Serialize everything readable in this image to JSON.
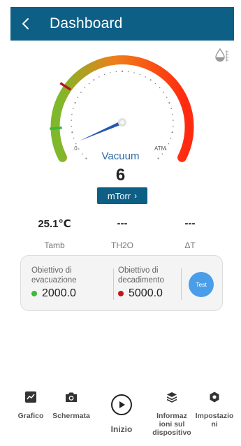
{
  "header": {
    "title": "Dashboard",
    "back_icon": "chevron-left-icon"
  },
  "top_right_icon": "water-drop-icon",
  "gauge": {
    "label": "Vacuum",
    "value": "6",
    "min_label": ".0",
    "max_label": "ATM.",
    "unit": "mTorr",
    "unit_chevron": "›",
    "needle_fraction": 0.08,
    "colors": {
      "green": "#7fb82a",
      "orange": "#f07d1a",
      "red": "#ff2b10",
      "needle": "#2457b0"
    }
  },
  "readings": [
    {
      "value": "25.1℃",
      "label": "Tamb"
    },
    {
      "value": "---",
      "label": "TH2O"
    },
    {
      "value": "---",
      "label": "ΔT"
    }
  ],
  "targets": {
    "evacuation": {
      "title_line1": "Obiettivo di",
      "title_line2": "evacuazione",
      "value": "2000.0",
      "dot_color": "#3db83a"
    },
    "decay": {
      "title_line1": "Obiettivo di",
      "title_line2": "decadimento",
      "value": "5000.0",
      "dot_color": "#c0161c"
    },
    "test_button": "Test"
  },
  "nav": {
    "grafico": {
      "label": "Grafico",
      "icon": "chart-icon"
    },
    "schermata": {
      "label": "Schermata",
      "icon": "camera-icon"
    },
    "inizio": {
      "label": "Inizio",
      "icon": "play-icon"
    },
    "info_line1": "Informaz",
    "info_line2": "ioni sul",
    "info_line3": "dispositivo",
    "info_icon": "layers-icon",
    "settings_line1": "Impostazio",
    "settings_line2": "ni",
    "settings_icon": "settings-icon"
  }
}
